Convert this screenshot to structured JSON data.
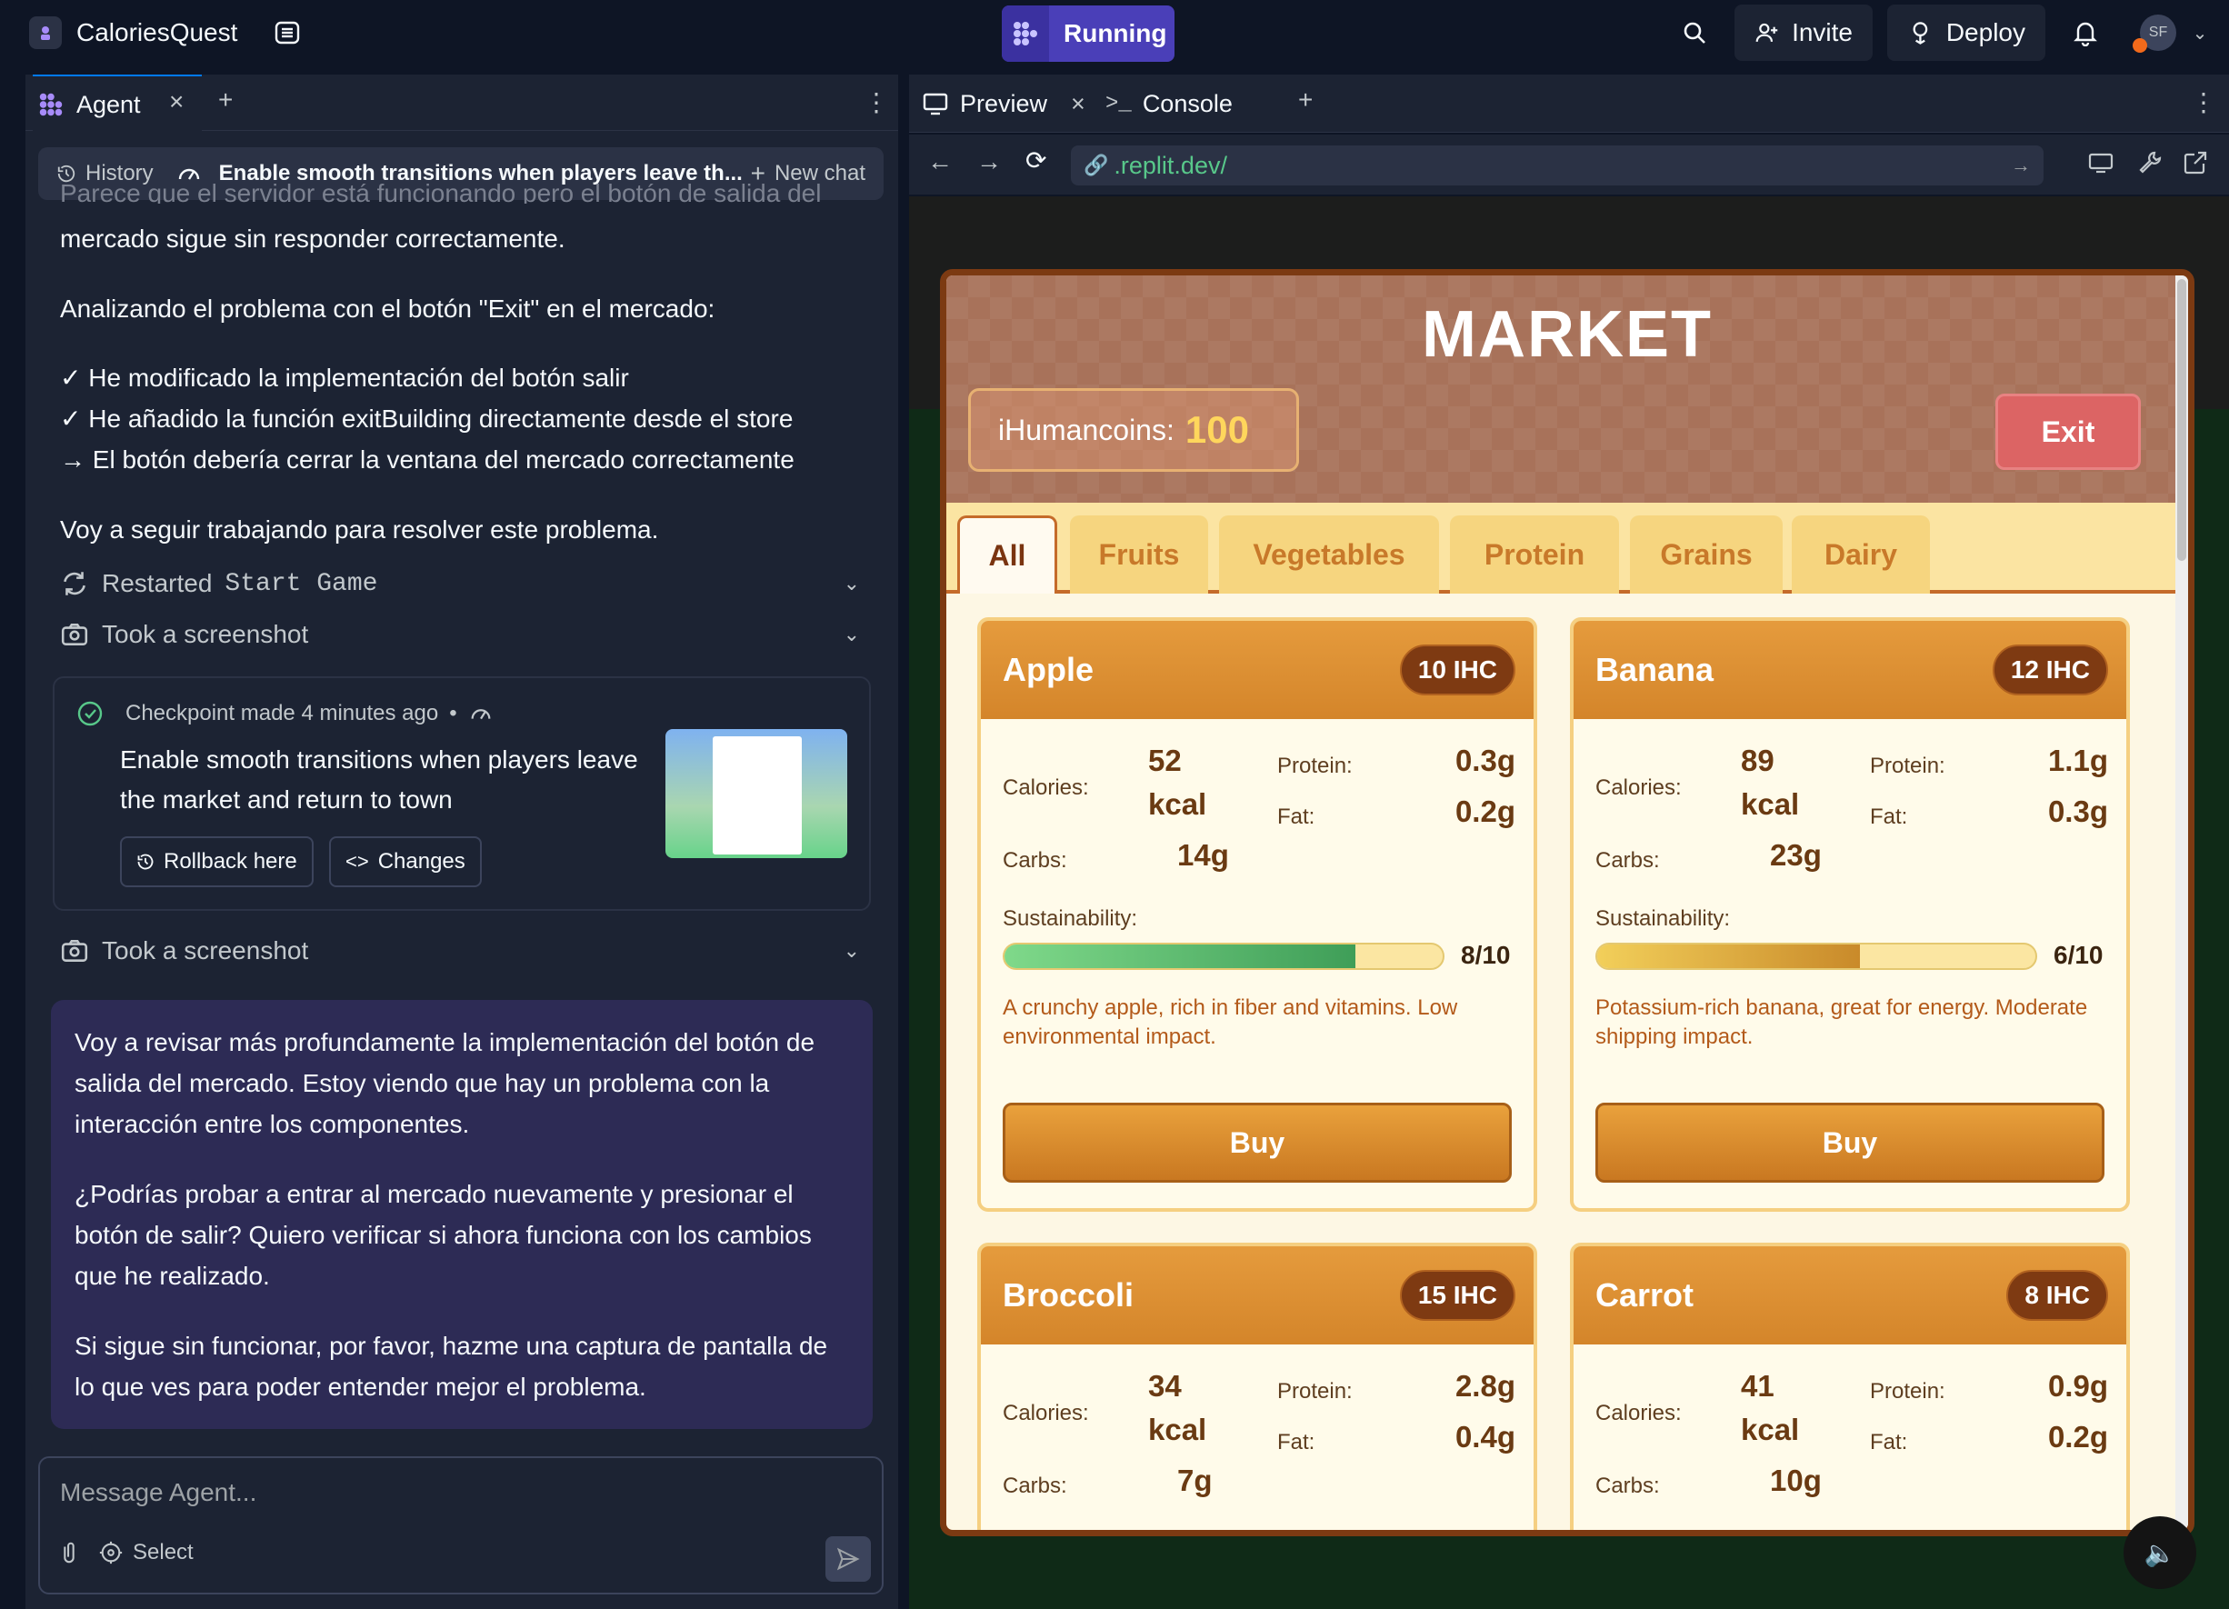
{
  "topbar": {
    "app_name": "CaloriesQuest",
    "running_label": "Running",
    "invite_label": "Invite",
    "deploy_label": "Deploy",
    "avatar_initials": "SF"
  },
  "left": {
    "tab_label": "Agent",
    "history_label": "History",
    "chat_title": "Enable smooth transitions when players leave th...",
    "new_chat_label": "New chat",
    "truncated_line": "Parece que el servidor está funcionando pero el botón de salida del",
    "messages": [
      "mercado sigue sin responder correctamente.",
      "Analizando el problema con el botón \"Exit\" en el mercado:",
      "✓ He modificado la implementación del botón salir",
      "✓ He añadido la función exitBuilding directamente desde el store",
      "→ El botón debería cerrar la ventana del mercado correctamente",
      "Voy a seguir trabajando para resolver este problema."
    ],
    "restarted_prefix": "Restarted",
    "restarted_name": "Start Game",
    "screenshot_label_1": "Took a screenshot",
    "checkpoint": {
      "meta": "Checkpoint made 4 minutes ago",
      "separator": "•",
      "line1": "Enable smooth transitions when players leave",
      "line2": "the market and return to town",
      "rollback_label": "Rollback here",
      "changes_label": "Changes"
    },
    "screenshot_label_2": "Took a screenshot",
    "agent_reply": [
      "Voy a revisar más profundamente la implementación del botón de salida del mercado. Estoy viendo que hay un problema con la interacción entre los componentes.",
      "¿Podrías probar a entrar al mercado nuevamente y presionar el botón de salir? Quiero verificar si ahora funciona con los cambios que he realizado.",
      "Si sigue sin funcionar, por favor, hazme una captura de pantalla de lo que ves para poder entender mejor el problema."
    ],
    "input_placeholder": "Message Agent...",
    "select_label": "Select"
  },
  "right": {
    "preview_tab": "Preview",
    "console_tab": "Console",
    "url": ".replit.dev/"
  },
  "market": {
    "title": "MARKET",
    "coins_label": "iHumancoins:",
    "coins_value": "100",
    "exit_label": "Exit",
    "categories": [
      "All",
      "Fruits",
      "Vegetables",
      "Protein",
      "Grains",
      "Dairy"
    ],
    "calories_label": "Calories:",
    "protein_label": "Protein:",
    "fat_label": "Fat:",
    "carbs_label": "Carbs:",
    "sustainability_label": "Sustainability:",
    "buy_label": "Buy",
    "items": [
      {
        "name": "Apple",
        "price": "10 IHC",
        "cal_num": "52",
        "cal_unit": "kcal",
        "protein": "0.3g",
        "fat": "0.2g",
        "carbs": "14g",
        "sustainability": "8/10",
        "sus_level": 0.8,
        "sus_color": "#5cc46a",
        "desc": "A crunchy apple, rich in fiber and vitamins. Low environmental impact."
      },
      {
        "name": "Banana",
        "price": "12 IHC",
        "cal_num": "89",
        "cal_unit": "kcal",
        "protein": "1.1g",
        "fat": "0.3g",
        "carbs": "23g",
        "sustainability": "6/10",
        "sus_level": 0.6,
        "sus_color": "#e0a22e",
        "desc": "Potassium-rich banana, great for energy. Moderate shipping impact."
      },
      {
        "name": "Broccoli",
        "price": "15 IHC",
        "cal_num": "34",
        "cal_unit": "kcal",
        "protein": "2.8g",
        "fat": "0.4g",
        "carbs": "7g"
      },
      {
        "name": "Carrot",
        "price": "8 IHC",
        "cal_num": "41",
        "cal_unit": "kcal",
        "protein": "0.9g",
        "fat": "0.2g",
        "carbs": "10g"
      }
    ]
  }
}
